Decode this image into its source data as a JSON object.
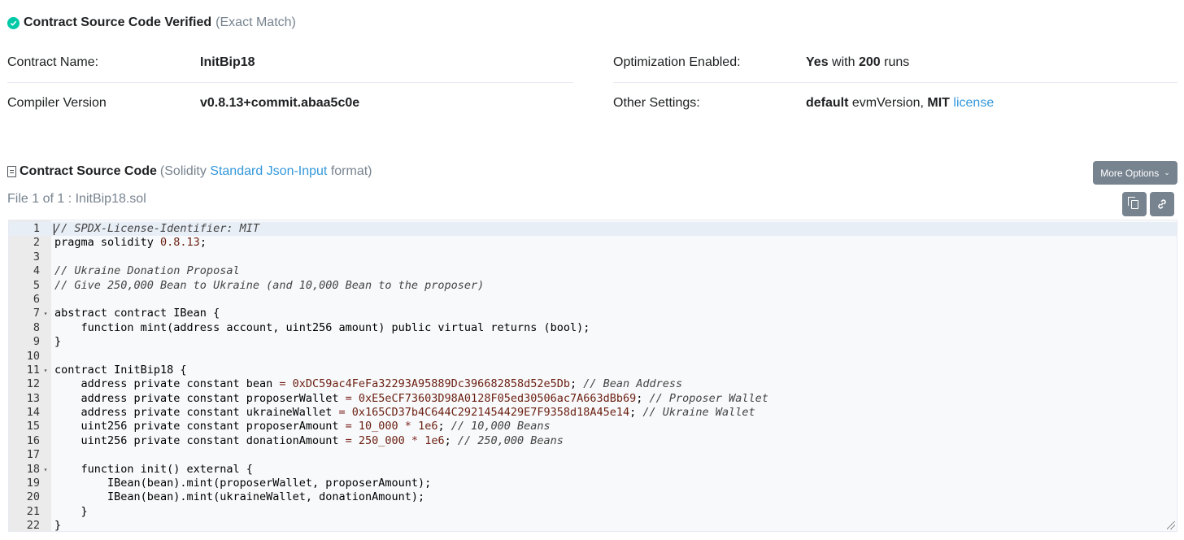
{
  "verified": {
    "title": "Contract Source Code Verified",
    "match": "(Exact Match)"
  },
  "details": {
    "contract_name_label": "Contract Name:",
    "contract_name": "InitBip18",
    "compiler_label": "Compiler Version",
    "compiler": "v0.8.13+commit.abaa5c0e",
    "optimization_label": "Optimization Enabled:",
    "optimization_enabled": "Yes",
    "optimization_with": "with",
    "optimization_runs": "200",
    "optimization_runs_suffix": "runs",
    "other_label": "Other Settings:",
    "other_default": "default",
    "other_evm": "evmVersion,",
    "other_mit": "MIT",
    "other_license": "license"
  },
  "source": {
    "title": "Contract Source Code",
    "format_prefix": "(Solidity",
    "format_link": "Standard Json-Input",
    "format_suffix": "format)",
    "more_options": "More Options",
    "file_line": "File 1 of 1 : InitBip18.sol"
  },
  "code_lines": [
    {
      "n": "1",
      "fold": "",
      "t": "// SPDX-License-Identifier: MIT"
    },
    {
      "n": "2",
      "fold": "",
      "t": "pragma solidity 0.8.13;"
    },
    {
      "n": "3",
      "fold": "",
      "t": ""
    },
    {
      "n": "4",
      "fold": "",
      "t": "// Ukraine Donation Proposal"
    },
    {
      "n": "5",
      "fold": "",
      "t": "// Give 250,000 Bean to Ukraine (and 10,000 Bean to the proposer)"
    },
    {
      "n": "6",
      "fold": "",
      "t": ""
    },
    {
      "n": "7",
      "fold": "▾",
      "t": "abstract contract IBean {"
    },
    {
      "n": "8",
      "fold": "",
      "t": "    function mint(address account, uint256 amount) public virtual returns (bool);"
    },
    {
      "n": "9",
      "fold": "",
      "t": "}"
    },
    {
      "n": "10",
      "fold": "",
      "t": ""
    },
    {
      "n": "11",
      "fold": "▾",
      "t": "contract InitBip18 {"
    },
    {
      "n": "12",
      "fold": "",
      "t": "    address private constant bean = 0xDC59ac4FeFa32293A95889Dc396682858d52e5Db; // Bean Address"
    },
    {
      "n": "13",
      "fold": "",
      "t": "    address private constant proposerWallet = 0xE5eCF73603D98A0128F05ed30506ac7A663dBb69; // Proposer Wallet"
    },
    {
      "n": "14",
      "fold": "",
      "t": "    address private constant ukraineWallet = 0x165CD37b4C644C2921454429E7F9358d18A45e14; // Ukraine Wallet"
    },
    {
      "n": "15",
      "fold": "",
      "t": "    uint256 private constant proposerAmount = 10_000 * 1e6; // 10,000 Beans"
    },
    {
      "n": "16",
      "fold": "",
      "t": "    uint256 private constant donationAmount = 250_000 * 1e6; // 250,000 Beans"
    },
    {
      "n": "17",
      "fold": "",
      "t": ""
    },
    {
      "n": "18",
      "fold": "▾",
      "t": "    function init() external {"
    },
    {
      "n": "19",
      "fold": "",
      "t": "        IBean(bean).mint(proposerWallet, proposerAmount);"
    },
    {
      "n": "20",
      "fold": "",
      "t": "        IBean(bean).mint(ukraineWallet, donationAmount);"
    },
    {
      "n": "21",
      "fold": "",
      "t": "    }"
    },
    {
      "n": "22",
      "fold": "",
      "t": "}"
    }
  ],
  "colors": {
    "accent": "#3498db",
    "verified_check": "#00c9a7",
    "button_bg": "#77838f",
    "keyword": "#8b1b1b",
    "comment": "#4a4a4a",
    "number": "#5c1a0e"
  },
  "icons": [
    "check-circle-icon",
    "document-icon",
    "chevron-down-icon",
    "copy-icon",
    "link-icon"
  ]
}
